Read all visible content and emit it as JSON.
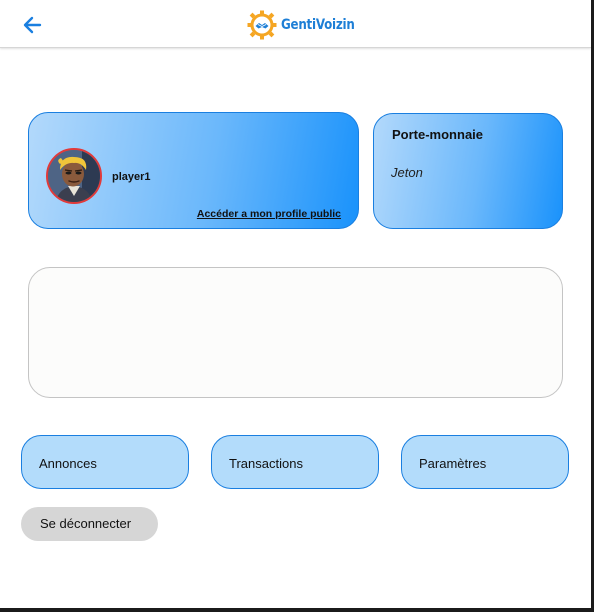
{
  "header": {
    "back_icon": "arrow-left-icon",
    "logo_icon": "gear-handshake-icon",
    "logo_text": "GentiVoizin"
  },
  "profile": {
    "username": "player1",
    "public_profile_link": "Accéder a mon profile public",
    "avatar": "cartoon-character-avatar"
  },
  "wallet": {
    "title": "Porte-monnaie",
    "token_label": "Jeton"
  },
  "nav": {
    "annonces": "Annonces",
    "transactions": "Transactions",
    "parametres": "Paramètres"
  },
  "logout": {
    "label": "Se déconnecter"
  },
  "colors": {
    "accent": "#1a7fe0",
    "card_gradient_start": "#b3d9fb",
    "card_gradient_end": "#1992fb",
    "nav_button_bg": "#b3dcfb",
    "logout_bg": "#d6d6d6",
    "avatar_border": "#e13a3a",
    "logo_text": "#1e7fd6"
  }
}
